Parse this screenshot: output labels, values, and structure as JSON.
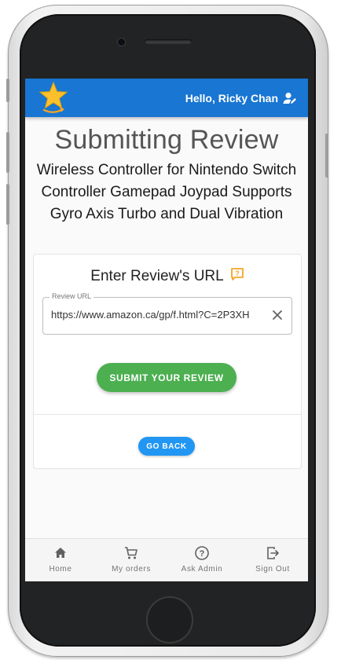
{
  "header": {
    "greeting": "Hello, Ricky Chan",
    "logo_icon": "star-icon",
    "user_icon": "user-edit-icon",
    "colors": {
      "appbar": "#1976d2",
      "star": "#fbc02d",
      "smile": "#f5a623"
    }
  },
  "page": {
    "title": "Submitting Review",
    "product_name": "Wireless Controller for Nintendo Switch Controller Gamepad Joypad Supports Gyro Axis Turbo and Dual Vibration"
  },
  "form": {
    "heading": "Enter Review's URL",
    "help_icon": "help-icon",
    "url_label": "Review URL",
    "url_value": "https://www.amazon.ca/gp/f.html?C=2P3XH",
    "clear_icon": "close-icon",
    "submit_label": "SUBMIT YOUR REVIEW",
    "back_label": "GO BACK",
    "colors": {
      "submit": "#4caf50",
      "back": "#2196f3",
      "help": "#f5a623"
    }
  },
  "bottom_nav": {
    "items": [
      {
        "label": "Home",
        "icon": "home-icon"
      },
      {
        "label": "My orders",
        "icon": "cart-icon"
      },
      {
        "label": "Ask Admin",
        "icon": "question-icon"
      },
      {
        "label": "Sign Out",
        "icon": "sign-out-icon"
      }
    ]
  }
}
